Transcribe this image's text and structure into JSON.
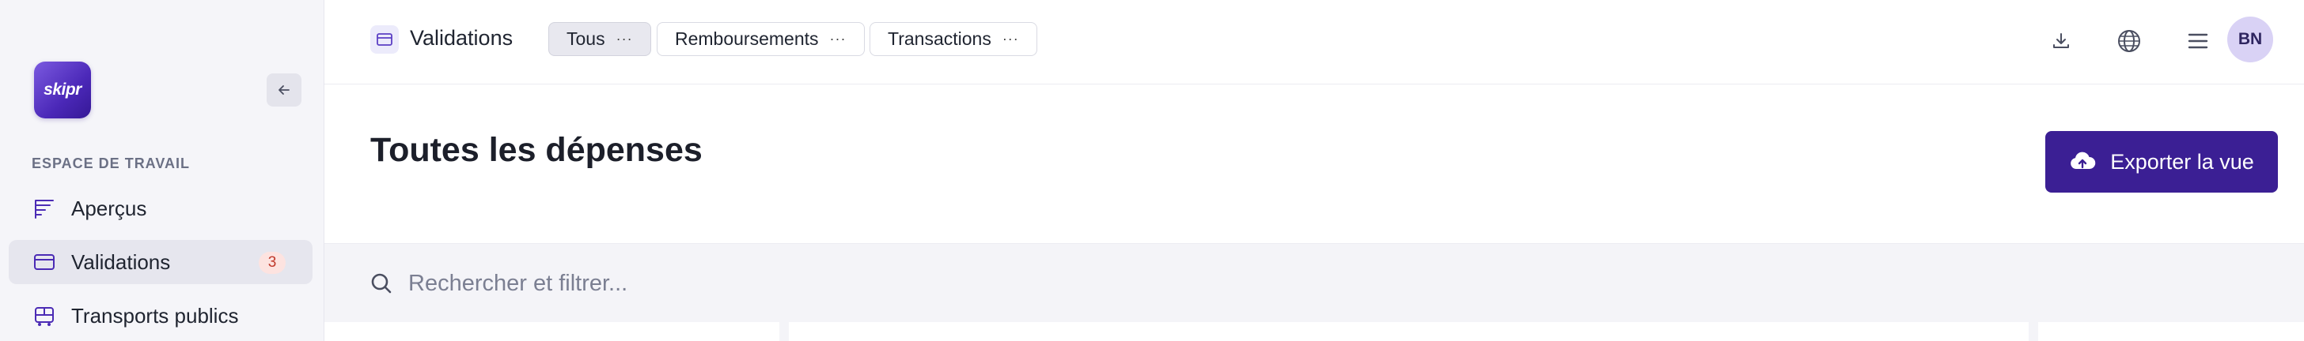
{
  "brand": {
    "logo_text": "skipr",
    "accent": "#3b1f94"
  },
  "sidebar": {
    "section_label": "ESPACE DE TRAVAIL",
    "collapse_icon": "arrow-left-icon",
    "items": [
      {
        "label": "Aperçus",
        "icon": "chart-bars-icon",
        "active": false
      },
      {
        "label": "Validations",
        "icon": "card-icon",
        "active": true,
        "badge": "3"
      },
      {
        "label": "Transports publics",
        "icon": "bus-icon",
        "active": false
      }
    ]
  },
  "topbar": {
    "title": "Validations",
    "tabs": [
      {
        "label": "Tous",
        "active": true
      },
      {
        "label": "Remboursements",
        "active": false
      },
      {
        "label": "Transactions",
        "active": false
      }
    ],
    "more_glyph": "···",
    "actions": [
      "download-icon",
      "globe-icon",
      "menu-icon"
    ],
    "avatar_initials": "BN"
  },
  "main": {
    "title": "Toutes les dépenses",
    "export_label": "Exporter la vue"
  },
  "search": {
    "placeholder": "Rechercher et filtrer..."
  }
}
